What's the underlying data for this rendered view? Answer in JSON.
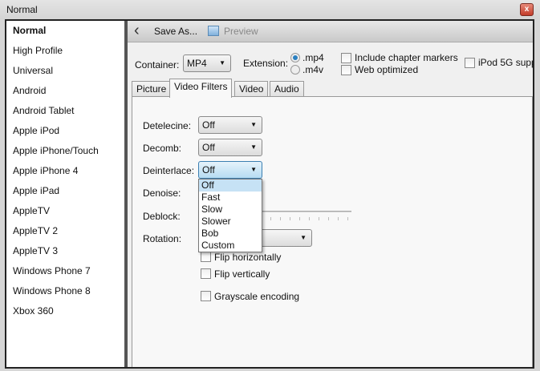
{
  "window": {
    "title": "Normal",
    "close": "x"
  },
  "sidebar": {
    "items": [
      {
        "label": "Normal"
      },
      {
        "label": "High Profile"
      },
      {
        "label": "Universal"
      },
      {
        "label": "Android"
      },
      {
        "label": "Android Tablet"
      },
      {
        "label": "Apple iPod"
      },
      {
        "label": "Apple iPhone/Touch"
      },
      {
        "label": "Apple iPhone 4"
      },
      {
        "label": "Apple iPad"
      },
      {
        "label": "AppleTV"
      },
      {
        "label": "AppleTV 2"
      },
      {
        "label": "AppleTV 3"
      },
      {
        "label": "Windows Phone 7"
      },
      {
        "label": "Windows Phone 8"
      },
      {
        "label": "Xbox 360"
      }
    ]
  },
  "toolbar": {
    "back": "‹",
    "save_as": "Save As...",
    "preview": "Preview"
  },
  "format": {
    "container_label": "Container:",
    "container_value": "MP4",
    "extension_label": "Extension:",
    "ext_mp4": ".mp4",
    "ext_m4v": ".m4v",
    "chapter_markers": "Include chapter markers",
    "web_optimized": "Web optimized",
    "ipod": "iPod 5G supp"
  },
  "tabs": [
    {
      "label": "Picture"
    },
    {
      "label": "Video Filters"
    },
    {
      "label": "Video"
    },
    {
      "label": "Audio"
    }
  ],
  "filters": {
    "detelecine_label": "Detelecine:",
    "detelecine_value": "Off",
    "decomb_label": "Decomb:",
    "decomb_value": "Off",
    "deinterlace_label": "Deinterlace:",
    "deinterlace_value": "Off",
    "denoise_label": "Denoise:",
    "deblock_label": "Deblock:",
    "rotation_label": "Rotation:",
    "flip_h": "Flip horizontally",
    "flip_v": "Flip vertically",
    "grayscale": "Grayscale encoding"
  },
  "deinterlace_options": [
    "Off",
    "Fast",
    "Slow",
    "Slower",
    "Bob",
    "Custom"
  ]
}
